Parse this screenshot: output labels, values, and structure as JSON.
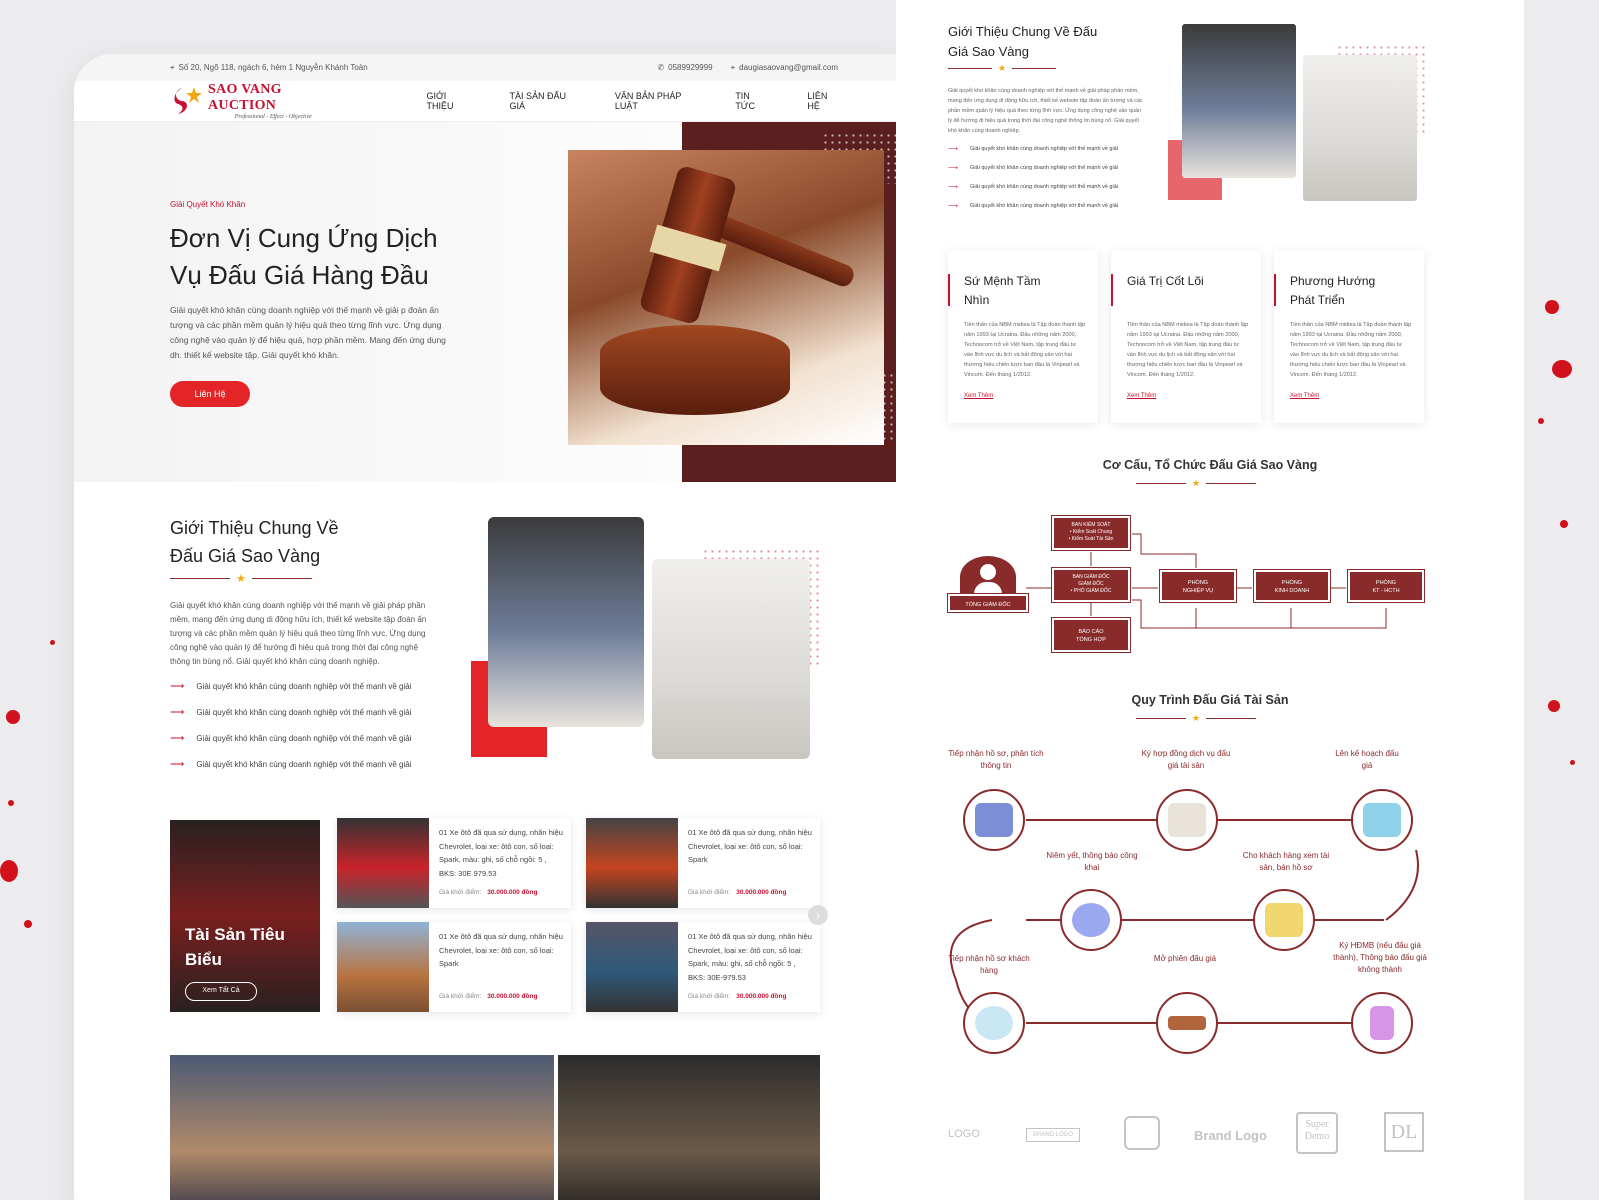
{
  "topbar": {
    "address": "Số 20, Ngõ 118, ngách 6, hẻm 1 Nguyễn Khánh Toàn",
    "phone": "0589929999",
    "email": "daugiasaovang@gmail.com"
  },
  "brand": {
    "name": "SAO VANG AUCTION",
    "tagline": "Professional - Effect - Objective"
  },
  "nav": [
    "GIỚI THIỆU",
    "TÀI SẢN ĐẤU GIÁ",
    "VĂN BẢN PHÁP LUẬT",
    "TIN TỨC",
    "LIÊN HỆ"
  ],
  "hero": {
    "eyebrow": "Giải Quyết Khó Khăn",
    "title": "Đơn Vị Cung Ứng Dịch Vụ Đấu Giá Hàng Đầu",
    "text": "Giải quyết khó khăn cùng doanh nghiệp với thế mạnh về giải p đoàn ấn tượng và các phần mềm quản lý hiệu quả theo từng lĩnh vực. Ứng dụng công nghệ vào quản lý để hiệu quả, hợp phần mềm. Mang đến ứng dụng dh. thiết kế website tập. Giải quyết khó khăn.",
    "cta": "Liên Hệ"
  },
  "intro": {
    "title": "Giới Thiệu Chung Về Đấu Giá Sao Vàng",
    "star": "★",
    "text": "Giải quyết khó khăn cùng doanh nghiệp với thế mạnh về giải pháp phần mềm, mang đến ứng dụng di động hữu ích, thiết kế website tập đoàn ấn tượng và các phần mềm quản lý hiệu quả theo từng lĩnh vực. Ứng dụng công nghệ vào quản lý để hướng đi hiệu quả trong thời đại công nghệ thông tin bùng nổ. Giải quyết khó khăn cùng doanh nghiệp.",
    "bullets": [
      "Giải quyết khó khăn cùng doanh nghiệp với thế mạnh về giải",
      "Giải quyết khó khăn cùng doanh nghiệp với thế mạnh về giải",
      "Giải quyết khó khăn cùng doanh nghiệp với thế mạnh về giải",
      "Giải quyết khó khăn cùng doanh nghiệp với thế mạnh về giải"
    ],
    "bullet_icon": "⟶"
  },
  "featured": {
    "title": "Tài Sản Tiêu Biểu",
    "button": "Xem Tất Cả"
  },
  "assets": [
    {
      "desc": "01 Xe ôtô đã qua sử dụng, nhãn hiệu Chevrolet, loại xe: ôtô con, số loại: Spark, màu: ghi, số chỗ ngồi: 5 , BKS: 30E 979.53",
      "price_label": "Giá khởi điểm:",
      "price": "30.000.000 đồng",
      "color": "#c9232a"
    },
    {
      "desc": "01 Xe ôtô đã qua sử dụng, nhãn hiệu Chevrolet, loại xe: ôtô con, số loại: Spark",
      "price_label": "Giá khởi điểm:",
      "price": "30.000.000 đồng",
      "color": "#c4451f"
    },
    {
      "desc": "01 Xe ôtô đã qua sử dụng, nhãn hiệu Chevrolet, loại xe: ôtô con, số loại: Spark",
      "price_label": "Giá khởi điểm:",
      "price": "30.000.000 đồng",
      "color": "#b9733f"
    },
    {
      "desc": "01 Xe ôtô đã qua sử dụng, nhãn hiệu Chevrolet, loại xe: ôtô con, số loại: Spark, màu: ghi, số chỗ ngồi: 5 , BKS: 30E-979.53",
      "price_label": "Giá khởi điểm:",
      "price": "30.000.000 đồng",
      "color": "#2f5a7a"
    }
  ],
  "right_intro": {
    "title": "Giới Thiệu Chung Về Đấu Giá Sao Vàng",
    "text": "Giải quyết khó khăn cùng doanh nghiệp với thế mạnh về giải pháp phần mềm, mang đến ứng dụng di động hữu ích, thiết kế website tập đoàn ấn tượng và các phần mềm quản lý hiệu quả theo từng lĩnh vực. Ứng dụng công nghệ vào quản lý để hướng đi hiệu quả trong thời đại công nghệ thông tin bùng nổ. Giải quyết khó khăn cùng doanh nghiệp.",
    "bullets": [
      "Giải quyết khó khăn cùng doanh nghiệp với thế mạnh về giải",
      "Giải quyết khó khăn cùng doanh nghiệp với thế mạnh về giải",
      "Giải quyết khó khăn cùng doanh nghiệp với thế mạnh về giải",
      "Giải quyết khó khăn cùng doanh nghiệp với thế mạnh về giải"
    ]
  },
  "values": [
    {
      "title": "Sứ Mệnh Tầm Nhìn",
      "text": "Tiền thân của NBM midiea là Tập đoàn thành lập năm 1993 tại Ucraina. Đầu những năm 2000, Technocom trở về Việt Nam, tập trung đầu tư vào lĩnh vực du lịch và bất động sản với hai thương hiệu chiến lược ban đầu là Vinpearl và Vincom. Đến tháng 1/2012.",
      "more": "Xem Thêm"
    },
    {
      "title": "Giá Trị Cốt Lõi",
      "text": "Tiền thân của NBM midiea là Tập đoàn thành lập năm 1993 tại Ucraina. Đầu những năm 2000, Technocom trở về Việt Nam, tập trung đầu tư vào lĩnh vực du lịch và bất động sản với hai thương hiệu chiến lược ban đầu là Vinpearl và Vincom. Đến tháng 1/2012.",
      "more": "Xem Thêm"
    },
    {
      "title": "Phương Hướng Phát Triển",
      "text": "Tiền thân của NBM midiea là Tập đoàn thành lập năm 1993 tại Ucraina. Đầu những năm 2000, Technocom trở về Việt Nam, tập trung đầu tư vào lĩnh vực du lịch và bất động sản với hai thương hiệu chiến lược ban đầu là Vinpearl và Vincom. Đến tháng 1/2012.",
      "more": "Xem Thêm"
    }
  ],
  "org": {
    "title": "Cơ Cấu, Tổ Chức Đấu Giá Sao Vàng",
    "ceo": "TỔNG GIÁM ĐỐC",
    "control": "BAN KIỂM SOÁT\n• Kiểm Soát Chung\n• Kiểm Soát Tài Sản",
    "board": "BAN GIÁM ĐỐC\nGIÁM ĐỐC\n• PHÓ GIÁM ĐỐC",
    "report": "BÁO CÁO\nTỔNG HỢP",
    "dept1": "PHÒNG\nNGHIỆP VỤ",
    "dept2": "PHÒNG\nKINH DOANH",
    "dept3": "PHÒNG\nKT - HCTH"
  },
  "process": {
    "title": "Quy Trình Đấu Giá Tài Sản",
    "steps": [
      "Tiếp nhận hồ sơ, phân tích thông tin",
      "Ký hợp đồng dịch vụ đấu giá tài sản",
      "Lên kế hoạch đấu giá",
      "Niêm yết, thông báo công khai",
      "Cho khách hàng xem tài sản, bán hồ sơ",
      "Tiếp nhận hồ sơ khách hàng",
      "Mở phiên đấu giá",
      "Ký HĐMB (nếu đấu giá thành), Thông báo đấu giá không thành"
    ]
  },
  "brands": [
    "LOGO",
    "BRAND LOGO",
    "Brand Logo",
    "Super Demo",
    "DL"
  ],
  "colors": {
    "accent": "#c8102e",
    "maroon": "#8a2b2b",
    "star": "#f3a712"
  }
}
